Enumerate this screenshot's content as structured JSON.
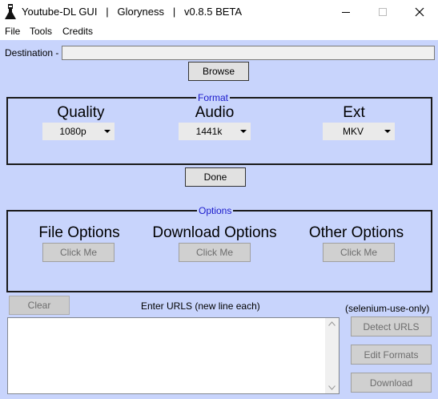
{
  "window": {
    "title": "Youtube-DL GUI   |   Gloryness   |   v0.8.5 BETA"
  },
  "menu": [
    "File",
    "Tools",
    "Credits"
  ],
  "destination": {
    "label": "Destination -",
    "value": "",
    "browse_label": "Browse"
  },
  "format": {
    "group_title": "Format",
    "quality": {
      "label": "Quality",
      "selected": "1080p"
    },
    "audio": {
      "label": "Audio",
      "selected": "1441k"
    },
    "ext": {
      "label": "Ext",
      "selected": "MKV"
    },
    "done_label": "Done"
  },
  "options": {
    "group_title": "Options",
    "file": {
      "label": "File Options",
      "button": "Click Me"
    },
    "download": {
      "label": "Download Options",
      "button": "Click Me"
    },
    "other": {
      "label": "Other Options",
      "button": "Click Me"
    }
  },
  "urls": {
    "clear_label": "Clear",
    "prompt": "Enter URLS (new line each)",
    "value": "",
    "selenium_note": "(selenium-use-only)",
    "detect_label": "Detect URLS",
    "edit_formats_label": "Edit Formats",
    "download_label": "Download"
  },
  "colors": {
    "background": "#c8d4fc",
    "group_title": "#1a1acc"
  }
}
